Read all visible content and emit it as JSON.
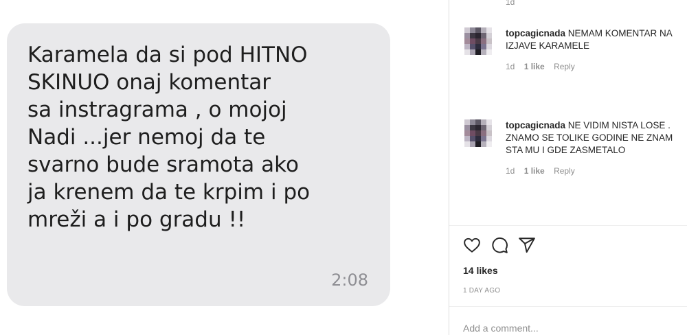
{
  "sms": {
    "text": "Karamela da si pod HITNO\nSKINUO onaj komentar\nsa instragrama  , o mojoj\nNadi ...jer nemoj da te\nsvarno bude sramota ako\nja krenem da te krpim i po\nmreži a i po gradu !!",
    "time": "2:08"
  },
  "instagram": {
    "top_meta": "1d",
    "comments": [
      {
        "username": "topcagicnada",
        "text": "NEMAM KOMENTAR NA IZJAVE KARAMELE",
        "time": "1d",
        "likes": "1 like",
        "reply": "Reply"
      },
      {
        "username": "topcagicnada",
        "text": "NE VIDIM NISTA LOSE . ZNAMO SE TOLIKE GODINE NE ZNAM STA MU I GDE ZASMETALO",
        "time": "1d",
        "likes": "1 like",
        "reply": "Reply"
      }
    ],
    "actions": [
      "heart-icon",
      "comment-icon",
      "share-icon"
    ],
    "likes_count": "14 likes",
    "post_date": "1 DAY AGO",
    "add_comment_placeholder": "Add a comment..."
  }
}
